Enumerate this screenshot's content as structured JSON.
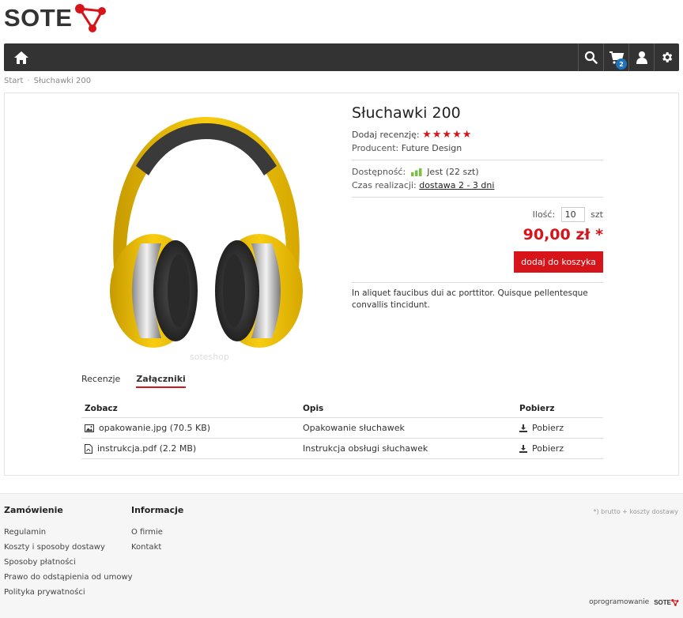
{
  "brand": {
    "name": "SOTE",
    "color": "#d7141a"
  },
  "nav": {
    "cart_count": "2"
  },
  "breadcrumb": [
    "Start",
    "Słuchawki 200"
  ],
  "product": {
    "title": "Słuchawki 200",
    "review_label": "Dodaj recenzję:",
    "stars": "★★★★★",
    "producer_label": "Producent:",
    "producer": "Future Design",
    "availability_label": "Dostępność:",
    "availability": "Jest",
    "stock": "(22 szt)",
    "lead_time_label": "Czas realizacji:",
    "lead_time": "dostawa 2 - 3 dni",
    "qty_label": "Ilość:",
    "qty_value": "10",
    "qty_unit": "szt",
    "price": "90,00 zł *",
    "add_to_cart": "dodaj do koszyka",
    "description": "In aliquet faucibus dui ac porttitor. Quisque pellentesque convallis tincidunt.",
    "watermark": "soteshop"
  },
  "tabs": [
    {
      "label": "Recenzje",
      "active": false
    },
    {
      "label": "Załączniki",
      "active": true
    }
  ],
  "attachments": {
    "headers": [
      "Zobacz",
      "Opis",
      "Pobierz"
    ],
    "rows": [
      {
        "file": "opakowanie.jpg (70.5 KB)",
        "icon": "image-icon",
        "desc": "Opakowanie słuchawek",
        "download": "Pobierz"
      },
      {
        "file": "instrukcja.pdf (2.2 MB)",
        "icon": "pdf-icon",
        "desc": "Instrukcja obsługi słuchawek",
        "download": "Pobierz"
      }
    ]
  },
  "footer": {
    "col1": {
      "title": "Zamówienie",
      "links": [
        "Regulamin",
        "Koszty i sposoby dostawy",
        "Sposoby płatności",
        "Prawo do odstąpienia od umowy",
        "Polityka prywatności"
      ]
    },
    "col2": {
      "title": "Informacje",
      "links": [
        "O firmie",
        "Kontakt"
      ]
    },
    "note": "*) brutto + koszty dostawy",
    "powered": "oprogramowanie",
    "powered_brand": "SOTE"
  }
}
